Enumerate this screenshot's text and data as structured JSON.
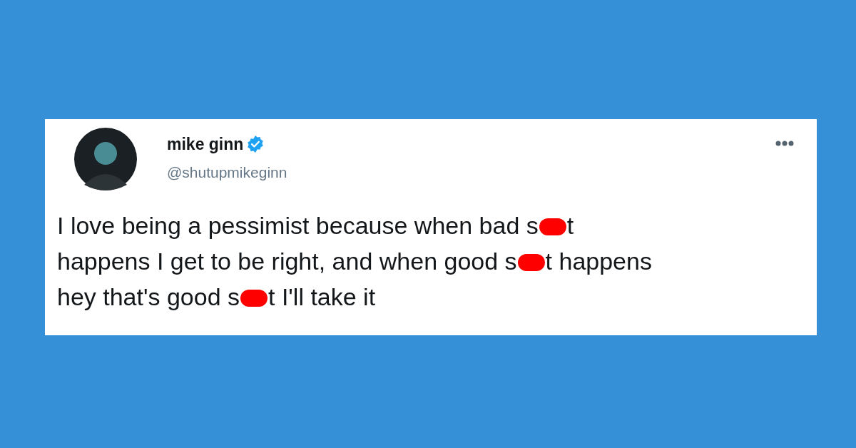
{
  "tweet": {
    "author": {
      "name": "mike ginn",
      "verified": true,
      "handle": "@shutupmikeginn"
    },
    "lines": [
      [
        {
          "kind": "text",
          "text": "I love being a pessimist because when bad s"
        },
        {
          "kind": "censor"
        },
        {
          "kind": "text",
          "text": "t"
        }
      ],
      [
        {
          "kind": "text",
          "text": "happens I get to be right, and when good s"
        },
        {
          "kind": "censor"
        },
        {
          "kind": "text",
          "text": "t happens"
        }
      ],
      [
        {
          "kind": "text",
          "text": "hey that's good s"
        },
        {
          "kind": "censor"
        },
        {
          "kind": "text",
          "text": "t I'll take it"
        }
      ]
    ]
  }
}
